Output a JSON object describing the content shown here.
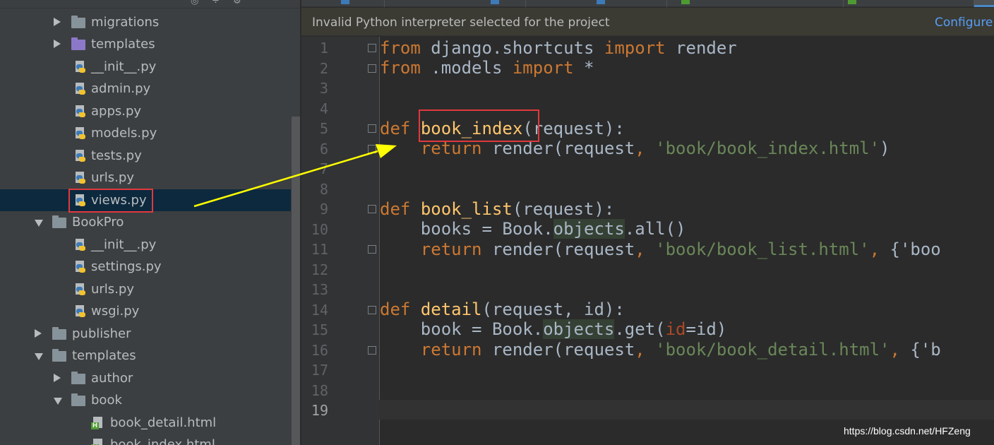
{
  "banner": {
    "message": "Invalid Python interpreter selected for the project",
    "action": "Configure"
  },
  "project_tree": [
    {
      "label": "migrations",
      "type": "folder",
      "expanded": false
    },
    {
      "label": "templates",
      "type": "folder-purple",
      "expanded": false
    },
    {
      "label": "__init__.py",
      "type": "py"
    },
    {
      "label": "admin.py",
      "type": "py"
    },
    {
      "label": "apps.py",
      "type": "py"
    },
    {
      "label": "models.py",
      "type": "py"
    },
    {
      "label": "tests.py",
      "type": "py"
    },
    {
      "label": "urls.py",
      "type": "py"
    },
    {
      "label": "views.py",
      "type": "py",
      "selected": true
    },
    {
      "label": "BookPro",
      "type": "folder",
      "expanded": true
    },
    {
      "label": "__init__.py",
      "type": "py"
    },
    {
      "label": "settings.py",
      "type": "py"
    },
    {
      "label": "urls.py",
      "type": "py"
    },
    {
      "label": "wsgi.py",
      "type": "py"
    },
    {
      "label": "publisher",
      "type": "folder",
      "expanded": false
    },
    {
      "label": "templates",
      "type": "folder",
      "expanded": true
    },
    {
      "label": "author",
      "type": "folder",
      "expanded": false
    },
    {
      "label": "book",
      "type": "folder",
      "expanded": true
    },
    {
      "label": "book_detail.html",
      "type": "html"
    },
    {
      "label": "book_index.html",
      "type": "html"
    }
  ],
  "editor": {
    "line_numbers": [
      "1",
      "2",
      "3",
      "4",
      "5",
      "6",
      "7",
      "8",
      "9",
      "10",
      "11",
      "12",
      "13",
      "14",
      "15",
      "16",
      "17",
      "18",
      "19"
    ],
    "current_line": 19,
    "code": {
      "l1_kw1": "from",
      "l1_mod": " django.shortcuts ",
      "l1_kw2": "import",
      "l1_name": " render",
      "l2_kw1": "from",
      "l2_mod": " .models ",
      "l2_kw2": "import",
      "l2_star": " *",
      "l5_def": "def",
      "l5_fn": "book_index",
      "l5_args": "(request):",
      "l6_ret": "return",
      "l6_call": " render(request",
      "l6_comma": ",",
      "l6_str": "'book/book_index.html'",
      "l6_end": ")",
      "l9_def": "def",
      "l9_fn": "book_list",
      "l9_args": "(request):",
      "l10_a": "books = Book.",
      "l10_occ": "objects",
      "l10_b": ".all()",
      "l11_ret": "return",
      "l11_call": " render(request",
      "l11_comma": ",",
      "l11_str": "'book/book_list.html'",
      "l11_comma2": ",",
      "l11_tail": "{'boo",
      "l14_def": "def",
      "l14_fn": "detail",
      "l14_args": "(request, id):",
      "l15_a": "book = Book.",
      "l15_occ": "objects",
      "l15_b": ".get(",
      "l15_param": "id",
      "l15_c": "=id)",
      "l16_ret": "return",
      "l16_call": " render(request",
      "l16_comma": ",",
      "l16_str": "'book/book_detail.html'",
      "l16_comma2": ",",
      "l16_tail": "{'b"
    }
  },
  "watermark": "https://blog.csdn.net/HFZeng",
  "colors": {
    "keyword": "#cc7832",
    "function": "#ffc66d",
    "string": "#6a8759",
    "annotation_box": "#e0393e",
    "annotation_arrow": "#ffff00",
    "selection": "#0d293e"
  }
}
